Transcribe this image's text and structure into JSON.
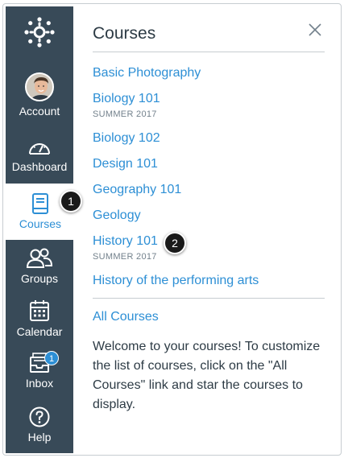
{
  "nav": {
    "items": [
      {
        "label": "Account",
        "icon": "avatar"
      },
      {
        "label": "Dashboard",
        "icon": "dashboard-icon"
      },
      {
        "label": "Courses",
        "icon": "courses-icon",
        "active": true
      },
      {
        "label": "Groups",
        "icon": "groups-icon"
      },
      {
        "label": "Calendar",
        "icon": "calendar-icon"
      },
      {
        "label": "Inbox",
        "icon": "inbox-icon",
        "badge": "1"
      },
      {
        "label": "Help",
        "icon": "help-icon"
      }
    ]
  },
  "tray": {
    "title": "Courses",
    "courses": [
      {
        "name": "Basic Photography",
        "term": ""
      },
      {
        "name": "Biology 101",
        "term": "SUMMER 2017"
      },
      {
        "name": "Biology 102",
        "term": ""
      },
      {
        "name": "Design 101",
        "term": ""
      },
      {
        "name": "Geography 101",
        "term": ""
      },
      {
        "name": "Geology",
        "term": ""
      },
      {
        "name": "History 101",
        "term": "SUMMER 2017"
      },
      {
        "name": "History of the performing arts",
        "term": ""
      }
    ],
    "all_courses": "All Courses",
    "welcome": "Welcome to your courses! To customize the list of courses, click on the \"All Courses\" link and star the courses to display."
  },
  "callouts": [
    "1",
    "2"
  ],
  "colors": {
    "nav_bg": "#384a58",
    "link": "#2d8fd5",
    "text": "#2d3b45",
    "muted": "#73818c"
  }
}
